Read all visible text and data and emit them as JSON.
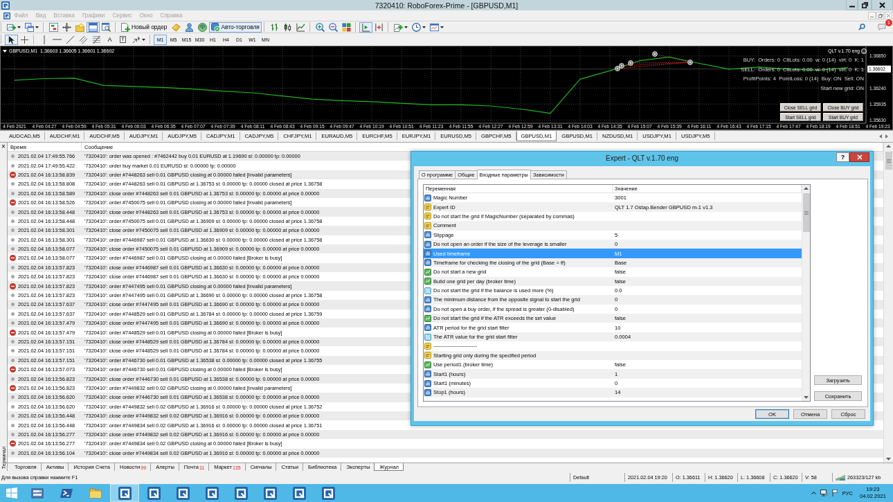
{
  "window": {
    "title": "7320410: RoboForex-Prime - [GBPUSD,M1]"
  },
  "menu": [
    {
      "label": "Файл",
      "disabled": true
    },
    {
      "label": "Вид",
      "disabled": true
    },
    {
      "label": "Вставка",
      "disabled": true
    },
    {
      "label": "Графики",
      "disabled": true
    },
    {
      "label": "Сервис",
      "disabled": true
    },
    {
      "label": "Окно",
      "disabled": true
    },
    {
      "label": "Справка",
      "disabled": true
    }
  ],
  "toolbar": [
    [
      {
        "kind": "new-chart",
        "on": false
      },
      {
        "kind": "profiles",
        "on": false
      }
    ],
    [
      {
        "kind": "market-watch",
        "on": false
      },
      {
        "kind": "data-window",
        "on": false
      },
      {
        "kind": "navigator",
        "on": false
      },
      {
        "kind": "terminal",
        "on": true
      },
      {
        "kind": "tester",
        "on": false
      }
    ],
    [
      {
        "kind": "new-order",
        "label": "Новый ордер",
        "on": false
      },
      {
        "kind": "metaeditor",
        "on": false
      },
      {
        "kind": "user",
        "on": false
      },
      {
        "kind": "signals",
        "on": false
      },
      {
        "kind": "autotrading",
        "label": "Авто-торговля",
        "on": true
      }
    ],
    [
      {
        "kind": "bar-chart",
        "on": false
      },
      {
        "kind": "candles",
        "on": false
      },
      {
        "kind": "line-chart",
        "on": false
      }
    ],
    [
      {
        "kind": "zoom-in",
        "on": false
      },
      {
        "kind": "zoom-out",
        "on": false
      },
      {
        "kind": "tile",
        "on": false
      }
    ],
    [
      {
        "kind": "autoscroll",
        "on": true
      },
      {
        "kind": "chart-shift",
        "on": false
      }
    ],
    [
      {
        "kind": "indicators",
        "on": false
      },
      {
        "kind": "periods",
        "on": false
      },
      {
        "kind": "templates",
        "on": false
      }
    ]
  ],
  "notifications": {
    "badge": "1"
  },
  "drawing_tools": [
    [
      {
        "kind": "cursor",
        "selected": true
      },
      {
        "kind": "crosshair",
        "selected": false
      }
    ],
    [
      {
        "kind": "vertical-line",
        "selected": false
      },
      {
        "kind": "horizontal-line",
        "selected": false
      },
      {
        "kind": "trend-line",
        "selected": false
      },
      {
        "kind": "channel",
        "selected": false
      },
      {
        "kind": "fibonacci",
        "selected": false
      },
      {
        "kind": "text",
        "label": "A",
        "selected": false
      },
      {
        "kind": "text-label",
        "label": "T",
        "selected": false
      },
      {
        "kind": "arrows",
        "selected": false
      }
    ]
  ],
  "timeframes": [
    {
      "label": "M1",
      "selected": true
    },
    {
      "label": "M5",
      "selected": false
    },
    {
      "label": "M15",
      "selected": false
    },
    {
      "label": "M30",
      "selected": false
    },
    {
      "label": "H1",
      "selected": false
    },
    {
      "label": "H4",
      "selected": false
    },
    {
      "label": "D1",
      "selected": false
    },
    {
      "label": "W1",
      "selected": false
    },
    {
      "label": "MN",
      "selected": false
    }
  ],
  "chart": {
    "symbol": "GBPUSD,M1  1.36603 1.36605 1.36601 1.36602",
    "expert": "QLT v.1.70 eng",
    "info": [
      "BUY:  Orders: 0  CtlLots: 0.00  w: 0 (14)  virt: 0  K: 1",
      "SELL:  Orders: 0  CtlLots: 0.00  w: 0 (14)  virt: 0  K: 1",
      "ProfitPoints: 4  PointLoss: 0 (14)  Buy: ON  Sell: ON",
      "Start new grid: ON"
    ],
    "buttons": [
      "Close SELL grid",
      "Close BUY grid",
      "Start SELL grid",
      "Start BUY grid"
    ],
    "chart_data": [
      {
        "type": "line",
        "categories": [
          "4 Feb 2021",
          "4 Feb 04:27",
          "4 Feb 04:59",
          "4 Feb 05:31",
          "4 Feb 06:03",
          "4 Feb 06:35",
          "4 Feb 07:07",
          "4 Feb 07:39",
          "4 Feb 08:11",
          "4 Feb 08:43",
          "4 Feb 09:15",
          "4 Feb 09:47",
          "4 Feb 10:19",
          "4 Feb 10:51",
          "4 Feb 11:23",
          "4 Feb 11:55",
          "4 Feb 12:27",
          "4 Feb 12:59",
          "4 Feb 13:31",
          "4 Feb 14:03",
          "4 Feb 14:35",
          "4 Feb 15:07",
          "4 Feb 15:39",
          "4 Feb 16:11",
          "4 Feb 16:43",
          "4 Feb 17:15",
          "4 Feb 17:47",
          "4 Feb 18:19",
          "4 Feb 18:51",
          "4 Feb 19:23"
        ],
        "values": [
          1.3639,
          1.3642,
          1.3643,
          1.3629,
          1.3627,
          1.3625,
          1.3622,
          1.3618,
          1.3615,
          1.3609,
          1.3603,
          1.36,
          1.3598,
          1.3595,
          1.3592,
          1.3592,
          1.359,
          1.3584,
          1.3576,
          1.3641,
          1.3657,
          1.3676,
          1.3683,
          1.3671,
          1.366,
          1.3664,
          1.366,
          1.3658,
          1.3663,
          null
        ],
        "color": "#1fb51f",
        "ylim": [
          1.3557,
          1.3702
        ],
        "yticks": [
          {
            "value": 1.3563,
            "label": "1.35630"
          },
          {
            "value": 1.35935,
            "label": "1.35935"
          },
          {
            "value": 1.3624,
            "label": "1.36240"
          },
          {
            "value": 1.3685,
            "label": "1.36850"
          }
        ],
        "grid": true,
        "ref_lines": [
          {
            "axis": "y",
            "value": 1.36602,
            "label": "1.36602"
          }
        ]
      }
    ]
  },
  "symbol_tabs": [
    {
      "label": "AUDCAD,M5",
      "selected": false
    },
    {
      "label": "AUDCHF,M1",
      "selected": false
    },
    {
      "label": "AUDCHF,M5",
      "selected": false
    },
    {
      "label": "AUDJPY,M1",
      "selected": false
    },
    {
      "label": "AUDJPY,M5",
      "selected": false
    },
    {
      "label": "CADJPY,M1",
      "selected": false
    },
    {
      "label": "CADJPY,M5",
      "selected": false
    },
    {
      "label": "CHFJPY,M1",
      "selected": false
    },
    {
      "label": "EURAUD,M5",
      "selected": false
    },
    {
      "label": "EURCHF,M5",
      "selected": false
    },
    {
      "label": "EURJPY,M1",
      "selected": false
    },
    {
      "label": "EURUSD,M5",
      "selected": false
    },
    {
      "label": "GBPCHF,M5",
      "selected": false
    },
    {
      "label": "GBPUSD,M1",
      "selected": true
    },
    {
      "label": "GBPUSD,M1",
      "selected": false
    },
    {
      "label": "NZDUSD,M1",
      "selected": false
    },
    {
      "label": "USDJPY,M1",
      "selected": false
    },
    {
      "label": "USDJPY,M5",
      "selected": false
    }
  ],
  "terminal": {
    "title": "Терминал",
    "close": "×",
    "columns": [
      "Время",
      "Сообщение"
    ],
    "rows": [
      {
        "kind": "info",
        "time": "2021.02.04 17:49:55.766",
        "message": "'7320410': order was opened : #7462442 buy 0.01 EURUSD at 1.19690 sl: 0.00000 tp: 0.00000"
      },
      {
        "kind": "info",
        "time": "2021.02.04 17:49:55.422",
        "message": "'7320410': order buy market 0.01 EURUSD sl: 0.00000 tp: 0.00000"
      },
      {
        "kind": "error",
        "time": "2021.02.04 16:13:58.839",
        "message": "'7320410': order #7448263 sell 0.01 GBPUSD closing at 0.00000 failed [Invalid parameters]"
      },
      {
        "kind": "info",
        "time": "2021.02.04 16:13:58.808",
        "message": "'7320410': order #7448263 sell 0.01 GBPUSD at 1.36753 sl: 0.00000 tp: 0.00000 closed at price 1.36758"
      },
      {
        "kind": "info",
        "time": "2021.02.04 16:13:58.589",
        "message": "'7320410': close order #7448263 sell 0.01 GBPUSD at 1.36753 sl: 0.00000 tp: 0.00000 at price 0.00000"
      },
      {
        "kind": "error",
        "time": "2021.02.04 16:13:58.526",
        "message": "'7320410': order #7450075 sell 0.01 GBPUSD closing at 0.00000 failed [Invalid parameters]"
      },
      {
        "kind": "info",
        "time": "2021.02.04 16:13:58.448",
        "message": "'7320410': close order #7448263 sell 0.01 GBPUSD at 1.36753 sl: 0.00000 tp: 0.00000 at price 0.00000"
      },
      {
        "kind": "info",
        "time": "2021.02.04 16:13:58.448",
        "message": "'7320410': order #7450075 sell 0.01 GBPUSD at 1.36909 sl: 0.00000 tp: 0.00000 closed at price 1.36758"
      },
      {
        "kind": "info",
        "time": "2021.02.04 16:13:58.301",
        "message": "'7320410': close order #7450075 sell 0.01 GBPUSD at 1.36909 sl: 0.00000 tp: 0.00000 at price 0.00000"
      },
      {
        "kind": "info",
        "time": "2021.02.04 16:13:58.301",
        "message": "'7320410': order #7446987 sell 0.01 GBPUSD at 1.36630 sl: 0.00000 tp: 0.00000 closed at price 1.36758"
      },
      {
        "kind": "info",
        "time": "2021.02.04 16:13:58.077",
        "message": "'7320410': close order #7450075 sell 0.01 GBPUSD at 1.36909 sl: 0.00000 tp: 0.00000 at price 0.00000"
      },
      {
        "kind": "error",
        "time": "2021.02.04 16:13:58.077",
        "message": "'7320410': order #7446987 sell 0.01 GBPUSD closing at 0.00000 failed [Broker is busy]"
      },
      {
        "kind": "info",
        "time": "2021.02.04 16:13:57.823",
        "message": "'7320410': close order #7446987 sell 0.01 GBPUSD at 1.36630 sl: 0.00000 tp: 0.00000 at price 0.00000"
      },
      {
        "kind": "info",
        "time": "2021.02.04 16:13:57.823",
        "message": "'7320410': close order #7446987 sell 0.01 GBPUSD at 1.36630 sl: 0.00000 tp: 0.00000 at price 0.00000"
      },
      {
        "kind": "error",
        "time": "2021.02.04 16:13:57.823",
        "message": "'7320410': order #7447495 sell 0.01 GBPUSD closing at 0.00000 failed [Invalid parameters]"
      },
      {
        "kind": "info",
        "time": "2021.02.04 16:13:57.823",
        "message": "'7320410': order #7447495 sell 0.01 GBPUSD at 1.36690 sl: 0.00000 tp: 0.00000 closed at price 1.36758"
      },
      {
        "kind": "info",
        "time": "2021.02.04 16:13:57.637",
        "message": "'7320410': close order #7447495 sell 0.01 GBPUSD at 1.36690 sl: 0.00000 tp: 0.00000 at price 0.00000"
      },
      {
        "kind": "info",
        "time": "2021.02.04 16:13:57.637",
        "message": "'7320410': order #7448529 sell 0.01 GBPUSD at 1.36784 sl: 0.00000 tp: 0.00000 closed at price 1.36759"
      },
      {
        "kind": "info",
        "time": "2021.02.04 16:13:57.479",
        "message": "'7320410': close order #7447495 sell 0.01 GBPUSD at 1.36690 sl: 0.00000 tp: 0.00000 at price 0.00000"
      },
      {
        "kind": "error",
        "time": "2021.02.04 16:13:57.479",
        "message": "'7320410': order #7448529 sell 0.01 GBPUSD closing at 0.00000 failed [Broker is busy]"
      },
      {
        "kind": "info",
        "time": "2021.02.04 16:13:57.151",
        "message": "'7320410': close order #7448529 sell 0.01 GBPUSD at 1.36784 sl: 0.00000 tp: 0.00000 at price 0.00000"
      },
      {
        "kind": "info",
        "time": "2021.02.04 16:13:57.151",
        "message": "'7320410': close order #7448529 sell 0.01 GBPUSD at 1.36784 sl: 0.00000 tp: 0.00000 at price 0.00000"
      },
      {
        "kind": "info",
        "time": "2021.02.04 16:13:57.151",
        "message": "'7320410': order #7446730 sell 0.01 GBPUSD at 1.36538 sl: 0.00000 tp: 0.00000 closed at price 1.36755"
      },
      {
        "kind": "error",
        "time": "2021.02.04 16:13:57.073",
        "message": "'7320410': order #7446730 sell 0.01 GBPUSD closing at 0.00000 failed [Broker is busy]"
      },
      {
        "kind": "info",
        "time": "2021.02.04 16:13:56.823",
        "message": "'7320410': close order #7446730 sell 0.01 GBPUSD at 1.36538 sl: 0.00000 tp: 0.00000 at price 0.00000"
      },
      {
        "kind": "error",
        "time": "2021.02.04 16:13:56.823",
        "message": "'7320410': order #7449832 sell 0.02 GBPUSD closing at 0.00000 failed [Invalid parameters]"
      },
      {
        "kind": "info",
        "time": "2021.02.04 16:13:56.620",
        "message": "'7320410': close order #7446730 sell 0.01 GBPUSD at 1.36538 sl: 0.00000 tp: 0.00000 at price 0.00000"
      },
      {
        "kind": "info",
        "time": "2021.02.04 16:13:56.620",
        "message": "'7320410': order #7449832 sell 0.02 GBPUSD at 1.36916 sl: 0.00000 tp: 0.00000 closed at price 1.36752"
      },
      {
        "kind": "info",
        "time": "2021.02.04 16:13:56.448",
        "message": "'7320410': close order #7449832 sell 0.02 GBPUSD at 1.36916 sl: 0.00000 tp: 0.00000 at price 0.00000"
      },
      {
        "kind": "info",
        "time": "2021.02.04 16:13:56.448",
        "message": "'7320410': order #7449834 sell 0.02 GBPUSD at 1.36916 sl: 0.00000 tp: 0.00000 closed at price 1.36751"
      },
      {
        "kind": "info",
        "time": "2021.02.04 16:13:56.277",
        "message": "'7320410': close order #7449832 sell 0.02 GBPUSD at 1.36916 sl: 0.00000 tp: 0.00000 at price 0.00000"
      },
      {
        "kind": "error",
        "time": "2021.02.04 16:13:56.277",
        "message": "'7320410': order #7449834 sell 0.02 GBPUSD closing at 0.00000 failed [Broker is busy]"
      },
      {
        "kind": "info",
        "time": "2021.02.04 16:13:56.104",
        "message": "'7320410': close order #7449834 sell 0.02 GBPUSD at 1.36916 sl: 0.00000 tp: 0.00000 at price 0.00000"
      }
    ],
    "tabs": [
      {
        "label": "Торговля",
        "selected": false
      },
      {
        "label": "Активы",
        "selected": false
      },
      {
        "label": "История Счета",
        "selected": false
      },
      {
        "label": "Новости",
        "badge": "99",
        "selected": false
      },
      {
        "label": "Алерты",
        "selected": false
      },
      {
        "label": "Почта",
        "badge": "11",
        "selected": false
      },
      {
        "label": "Маркет",
        "badge": "135",
        "selected": false
      },
      {
        "label": "Сигналы",
        "selected": false
      },
      {
        "label": "Статьи",
        "selected": false
      },
      {
        "label": "Библиотека",
        "selected": false
      },
      {
        "label": "Эксперты",
        "selected": false
      },
      {
        "label": "Журнал",
        "selected": true
      }
    ]
  },
  "status_bar": {
    "help": "Для вызова справки нажмите F1",
    "profile": "Default",
    "time": "2021.02.04 19:20",
    "open": "O: 1.36611",
    "high": "H: 1.36620",
    "low": "L: 1.36608",
    "close": "C: 1.36620",
    "volume": "V: 58",
    "traffic": "263323/127 kb"
  },
  "taskbar": {
    "apps": [
      {
        "kind": "start",
        "selected": false
      },
      {
        "kind": "server-manager",
        "selected": false
      },
      {
        "kind": "powershell",
        "selected": false
      },
      {
        "kind": "explorer",
        "selected": false
      },
      {
        "kind": "terminal",
        "selected": true
      },
      {
        "kind": "terminal",
        "selected": false
      },
      {
        "kind": "terminal",
        "selected": false
      },
      {
        "kind": "terminal",
        "selected": false
      },
      {
        "kind": "terminal",
        "selected": false
      },
      {
        "kind": "terminal",
        "selected": false
      },
      {
        "kind": "terminal",
        "selected": false
      },
      {
        "kind": "terminal",
        "selected": false
      }
    ],
    "language": "РУС",
    "time": "19:23",
    "date": "04.02.2021"
  },
  "dialog": {
    "title": "Expert - QLT v.1.70 eng",
    "help": "?",
    "tabs": [
      {
        "label": "О программе",
        "selected": false
      },
      {
        "label": "Общие",
        "selected": false
      },
      {
        "label": "Входные параметры",
        "selected": true
      },
      {
        "label": "Зависимости",
        "selected": false
      }
    ],
    "columns": [
      "Переменная",
      "Значение"
    ],
    "params": [
      {
        "kind": "int",
        "name": "Magic Number",
        "value": "3001",
        "selected": false
      },
      {
        "kind": "string",
        "name": "Expert ID",
        "value": "QLT 1.7 Ostap.Bender GBPUSD m-1 v1.3",
        "selected": false
      },
      {
        "kind": "string",
        "name": "Do not start the grid if MagicNumber (separated by commas)",
        "selected": false
      },
      {
        "kind": "string",
        "name": "Comment",
        "selected": false
      },
      {
        "kind": "int",
        "name": "Slippage",
        "value": "5",
        "selected": false
      },
      {
        "kind": "int",
        "name": "Do not open an order if the size of the leverage is smaller",
        "value": "0",
        "selected": false
      },
      {
        "kind": "int",
        "name": "Used timeframe",
        "value": "M1",
        "selected": true
      },
      {
        "kind": "int",
        "name": "Timeframe for checking the closing of the grid (Base = tf)",
        "value": "Base",
        "selected": false
      },
      {
        "kind": "bool",
        "name": "Do not start a new grid",
        "value": "false",
        "selected": false
      },
      {
        "kind": "bool",
        "name": "Build one grid per day (broker time)",
        "value": "false",
        "selected": false
      },
      {
        "kind": "double",
        "name": "Do not start the grid if the balance is used more (%)",
        "value": "0.0",
        "selected": false
      },
      {
        "kind": "int",
        "name": "The minimum distance from the opposite signal to start the grid",
        "value": "0",
        "selected": false
      },
      {
        "kind": "int",
        "name": "Do not open a buy order, if the spread is greater (0-disabled)",
        "value": "0",
        "selected": false
      },
      {
        "kind": "bool",
        "name": "Do not start the grid if the ATR exceeds the set value",
        "value": "false",
        "selected": false
      },
      {
        "kind": "int",
        "name": "ATR period for the grid start filter",
        "value": "10",
        "selected": false
      },
      {
        "kind": "double",
        "name": "The ATR value for the grid start filter",
        "value": "0.0004",
        "selected": false
      },
      {
        "kind": "string",
        "name": "-------------------------",
        "selected": false
      },
      {
        "kind": "string",
        "name": "Starting grid only during the specified period",
        "selected": false
      },
      {
        "kind": "bool",
        "name": "Use period1 (broker time)",
        "value": "false",
        "selected": false
      },
      {
        "kind": "int",
        "name": "Start1 (hours)",
        "value": "1",
        "selected": false
      },
      {
        "kind": "int",
        "name": "Start1 (minutes)",
        "value": "0",
        "selected": false
      },
      {
        "kind": "int",
        "name": "Stop1 (hours)",
        "value": "14",
        "selected": false
      }
    ],
    "side_buttons": [
      "Загрузить",
      "Сохранить"
    ],
    "buttons": [
      {
        "label": "OK",
        "default": true
      },
      {
        "label": "Отмена",
        "default": false
      },
      {
        "label": "Сброс",
        "default": false
      }
    ]
  }
}
